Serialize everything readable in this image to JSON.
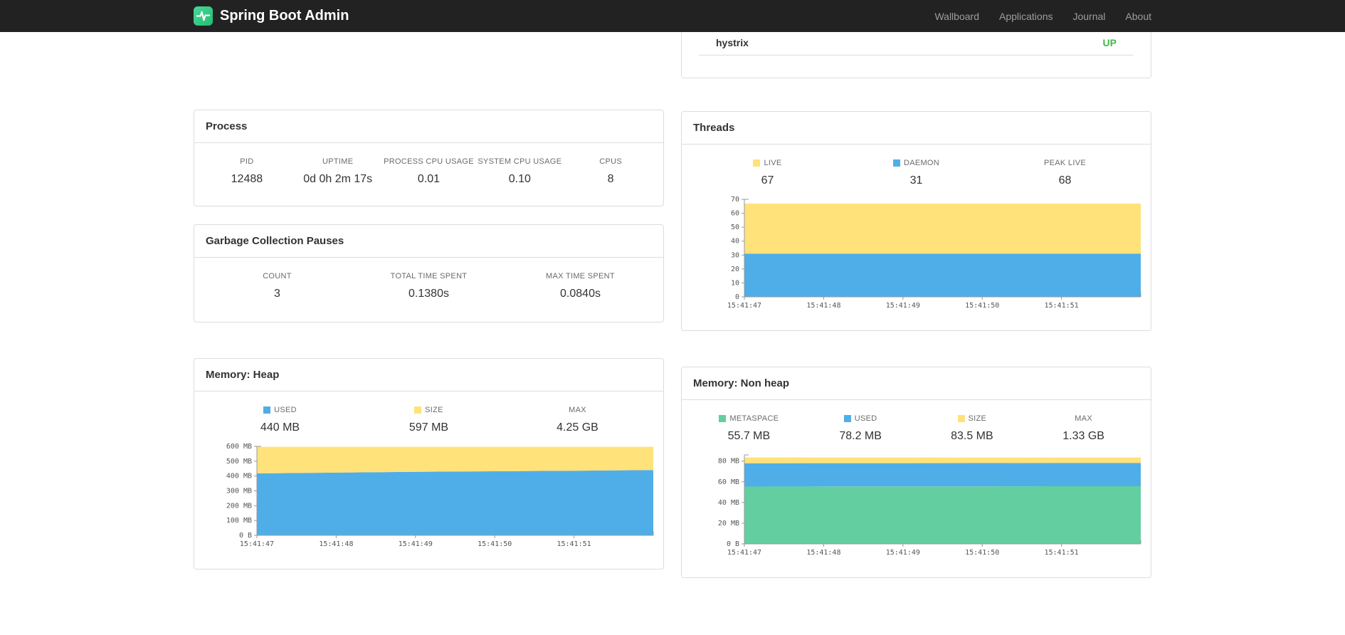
{
  "navbar": {
    "brand": "Spring Boot Admin",
    "links": [
      {
        "label": "Wallboard"
      },
      {
        "label": "Applications"
      },
      {
        "label": "Journal"
      },
      {
        "label": "About"
      }
    ]
  },
  "colors": {
    "navbar_bg": "#222222",
    "status_up": "#43b749",
    "chart_blue": "#4FAEE8",
    "chart_yellow": "#FFE27A",
    "chart_green": "#63CFA0",
    "logo_green": "#2FC27E"
  },
  "health_panel": {
    "row_label": "hystrix",
    "row_status": "UP"
  },
  "panels": {
    "process": {
      "title": "Process",
      "stats": [
        {
          "label": "PID",
          "value": "12488"
        },
        {
          "label": "UPTIME",
          "value": "0d 0h 2m 17s"
        },
        {
          "label": "PROCESS CPU USAGE",
          "value": "0.01"
        },
        {
          "label": "SYSTEM CPU USAGE",
          "value": "0.10"
        },
        {
          "label": "CPUS",
          "value": "8"
        }
      ]
    },
    "gc": {
      "title": "Garbage Collection Pauses",
      "stats": [
        {
          "label": "COUNT",
          "value": "3"
        },
        {
          "label": "TOTAL TIME SPENT",
          "value": "0.1380s"
        },
        {
          "label": "MAX TIME SPENT",
          "value": "0.0840s"
        }
      ]
    },
    "threads": {
      "title": "Threads",
      "stats": [
        {
          "label": "LIVE",
          "value": "67",
          "swatch": "#FFE27A"
        },
        {
          "label": "DAEMON",
          "value": "31",
          "swatch": "#4FAEE8"
        },
        {
          "label": "PEAK LIVE",
          "value": "68"
        }
      ]
    },
    "heap": {
      "title": "Memory: Heap",
      "stats": [
        {
          "label": "USED",
          "value": "440 MB",
          "swatch": "#4FAEE8"
        },
        {
          "label": "SIZE",
          "value": "597 MB",
          "swatch": "#FFE27A"
        },
        {
          "label": "MAX",
          "value": "4.25 GB"
        }
      ]
    },
    "nonheap": {
      "title": "Memory: Non heap",
      "stats": [
        {
          "label": "METASPACE",
          "value": "55.7 MB",
          "swatch": "#63CFA0"
        },
        {
          "label": "USED",
          "value": "78.2 MB",
          "swatch": "#4FAEE8"
        },
        {
          "label": "SIZE",
          "value": "83.5 MB",
          "swatch": "#FFE27A"
        },
        {
          "label": "MAX",
          "value": "1.33 GB"
        }
      ]
    }
  },
  "chart_data": [
    {
      "id": "threads",
      "type": "area",
      "stacked": true,
      "title": "Threads",
      "grid": false,
      "legend_position": "top",
      "x_labels": [
        "15:41:47",
        "15:41:48",
        "15:41:49",
        "15:41:50",
        "15:41:51"
      ],
      "x_points": 6,
      "ylim": [
        0,
        70
      ],
      "yticks": [
        {
          "v": 0,
          "label": "0"
        },
        {
          "v": 10,
          "label": "10"
        },
        {
          "v": 20,
          "label": "20"
        },
        {
          "v": 30,
          "label": "30"
        },
        {
          "v": 40,
          "label": "40"
        },
        {
          "v": 50,
          "label": "50"
        },
        {
          "v": 60,
          "label": "60"
        },
        {
          "v": 70,
          "label": "70"
        }
      ],
      "series_note": "tops = cumulative stacked upper boundary of each band",
      "series": [
        {
          "name": "DAEMON",
          "color": "#4FAEE8",
          "tops": [
            31,
            31,
            31,
            31,
            31,
            31
          ]
        },
        {
          "name": "LIVE",
          "color": "#FFE27A",
          "tops": [
            67,
            67,
            67,
            67,
            67,
            67
          ]
        }
      ]
    },
    {
      "id": "heap",
      "type": "area",
      "stacked": true,
      "title": "Memory: Heap (MB)",
      "grid": false,
      "legend_position": "top",
      "x_labels": [
        "15:41:47",
        "15:41:48",
        "15:41:49",
        "15:41:50",
        "15:41:51"
      ],
      "x_points": 6,
      "ylim": [
        0,
        600
      ],
      "yticks": [
        {
          "v": 0,
          "label": "0 B"
        },
        {
          "v": 100,
          "label": "100 MB"
        },
        {
          "v": 200,
          "label": "200 MB"
        },
        {
          "v": 300,
          "label": "300 MB"
        },
        {
          "v": 400,
          "label": "400 MB"
        },
        {
          "v": 500,
          "label": "500 MB"
        },
        {
          "v": 600,
          "label": "600 MB"
        }
      ],
      "series_note": "tops = cumulative stacked upper boundary of each band",
      "series": [
        {
          "name": "USED",
          "color": "#4FAEE8",
          "tops": [
            418,
            423,
            428,
            432,
            436,
            440
          ]
        },
        {
          "name": "SIZE",
          "color": "#FFE27A",
          "tops": [
            597,
            597,
            597,
            597,
            597,
            597
          ]
        }
      ]
    },
    {
      "id": "nonheap",
      "type": "area",
      "stacked": true,
      "title": "Memory: Non heap (MB)",
      "grid": false,
      "legend_position": "top",
      "x_labels": [
        "15:41:47",
        "15:41:48",
        "15:41:49",
        "15:41:50",
        "15:41:51"
      ],
      "x_points": 6,
      "ylim": [
        0,
        86
      ],
      "yticks": [
        {
          "v": 0,
          "label": "0 B"
        },
        {
          "v": 20,
          "label": "20 MB"
        },
        {
          "v": 40,
          "label": "40 MB"
        },
        {
          "v": 60,
          "label": "60 MB"
        },
        {
          "v": 80,
          "label": "80 MB"
        }
      ],
      "series_note": "tops = cumulative stacked upper boundary of each band",
      "series": [
        {
          "name": "METASPACE",
          "color": "#63CFA0",
          "tops": [
            55.4,
            55.5,
            55.5,
            55.6,
            55.7,
            55.7
          ]
        },
        {
          "name": "USED",
          "color": "#4FAEE8",
          "tops": [
            77.9,
            78.0,
            78.0,
            78.1,
            78.2,
            78.2
          ]
        },
        {
          "name": "SIZE",
          "color": "#FFE27A",
          "tops": [
            83.5,
            83.5,
            83.5,
            83.5,
            83.5,
            83.5
          ]
        }
      ]
    }
  ]
}
